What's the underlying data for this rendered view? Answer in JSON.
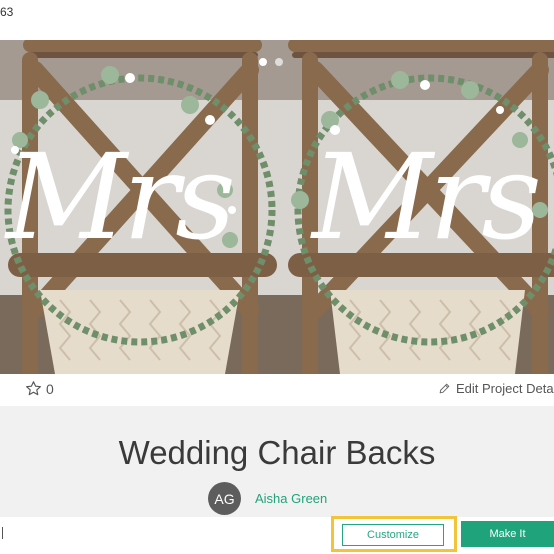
{
  "topbar": {
    "text": "63"
  },
  "hero": {
    "image_alt": "Two wooden chairs with white Mrs signs, eucalyptus wreaths and macrame",
    "sign_text": "Mrs",
    "slide_count": 2,
    "active_slide": 1
  },
  "actions": {
    "like_count": "0",
    "edit_label": "Edit Project Deta"
  },
  "project": {
    "title": "Wedding Chair Backs",
    "author_initials": "AG",
    "author_name": "Aisha Green"
  },
  "footer": {
    "customize_label": "Customize",
    "make_it_label": "Make It"
  },
  "colors": {
    "accent": "#1ea37b",
    "highlight": "#f2c43a",
    "avatar": "#5d5d5d"
  }
}
